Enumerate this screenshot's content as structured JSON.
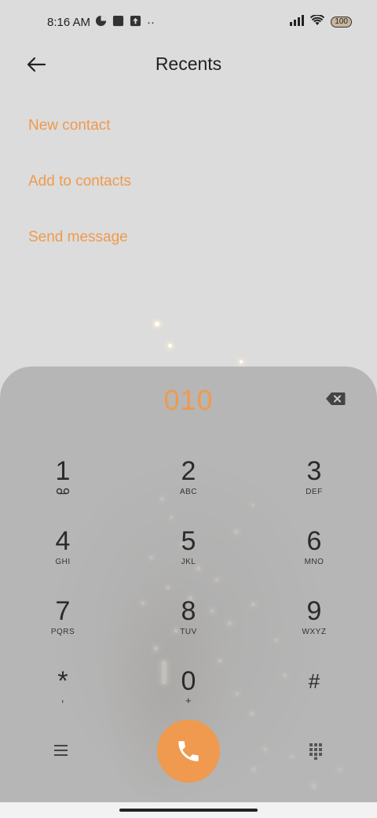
{
  "status_bar": {
    "time": "8:16 AM",
    "dots": "··",
    "battery": "100"
  },
  "header": {
    "title": "Recents"
  },
  "menu": {
    "items": [
      {
        "label": "New contact"
      },
      {
        "label": "Add to contacts"
      },
      {
        "label": "Send message"
      }
    ]
  },
  "dialer": {
    "number": "010",
    "keys": [
      {
        "digit": "1",
        "letters": ""
      },
      {
        "digit": "2",
        "letters": "ABC"
      },
      {
        "digit": "3",
        "letters": "DEF"
      },
      {
        "digit": "4",
        "letters": "GHI"
      },
      {
        "digit": "5",
        "letters": "JKL"
      },
      {
        "digit": "6",
        "letters": "MNO"
      },
      {
        "digit": "7",
        "letters": "PQRS"
      },
      {
        "digit": "8",
        "letters": "TUV"
      },
      {
        "digit": "9",
        "letters": "WXYZ"
      },
      {
        "digit": "*",
        "letters": ","
      },
      {
        "digit": "0",
        "letters": "+"
      },
      {
        "digit": "#",
        "letters": ""
      }
    ]
  },
  "colors": {
    "accent": "#ef9a4e",
    "panel": "#a8a8a8",
    "background": "#dcdcdc"
  },
  "icons": {
    "back": "arrow-left-icon",
    "backspace": "backspace-icon",
    "voicemail": "voicemail-icon",
    "call": "phone-icon",
    "menu": "hamburger-icon",
    "keypad": "dialpad-icon"
  }
}
